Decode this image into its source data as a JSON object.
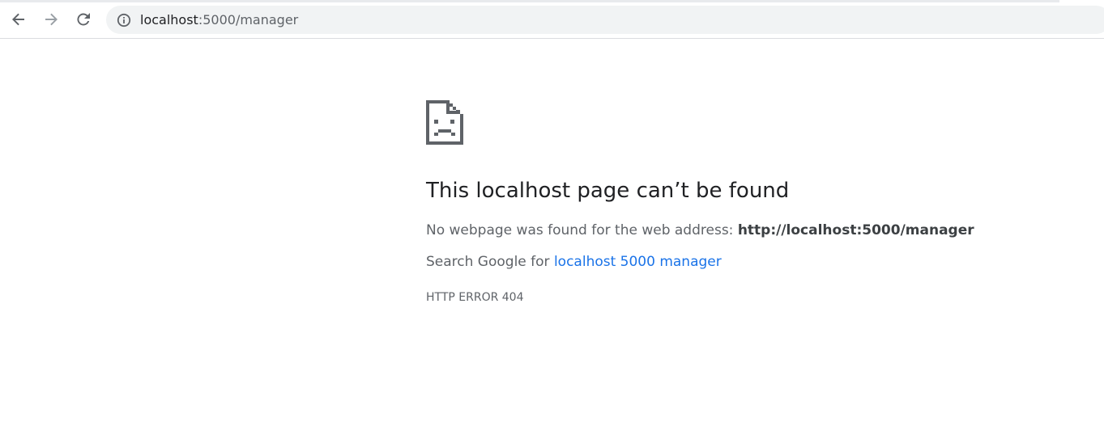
{
  "browser": {
    "address_bar": {
      "host": "localhost",
      "rest": ":5000/manager"
    },
    "icons": {
      "back": "arrow-left-icon",
      "forward": "arrow-right-icon",
      "reload": "reload-icon",
      "site_info": "info-circle-icon"
    }
  },
  "error_page": {
    "icon": "sad-page-icon",
    "title": "This localhost page can’t be found",
    "description_prefix": "No webpage was found for the web address: ",
    "description_url": "http://localhost:5000/manager",
    "search_prefix": "Search Google for ",
    "search_link": "localhost 5000 manager",
    "error_code": "HTTP ERROR 404"
  },
  "colors": {
    "link": "#1a73e8",
    "text_primary": "#202124",
    "text_secondary": "#5f6368",
    "omnibox_bg": "#f1f3f4"
  }
}
